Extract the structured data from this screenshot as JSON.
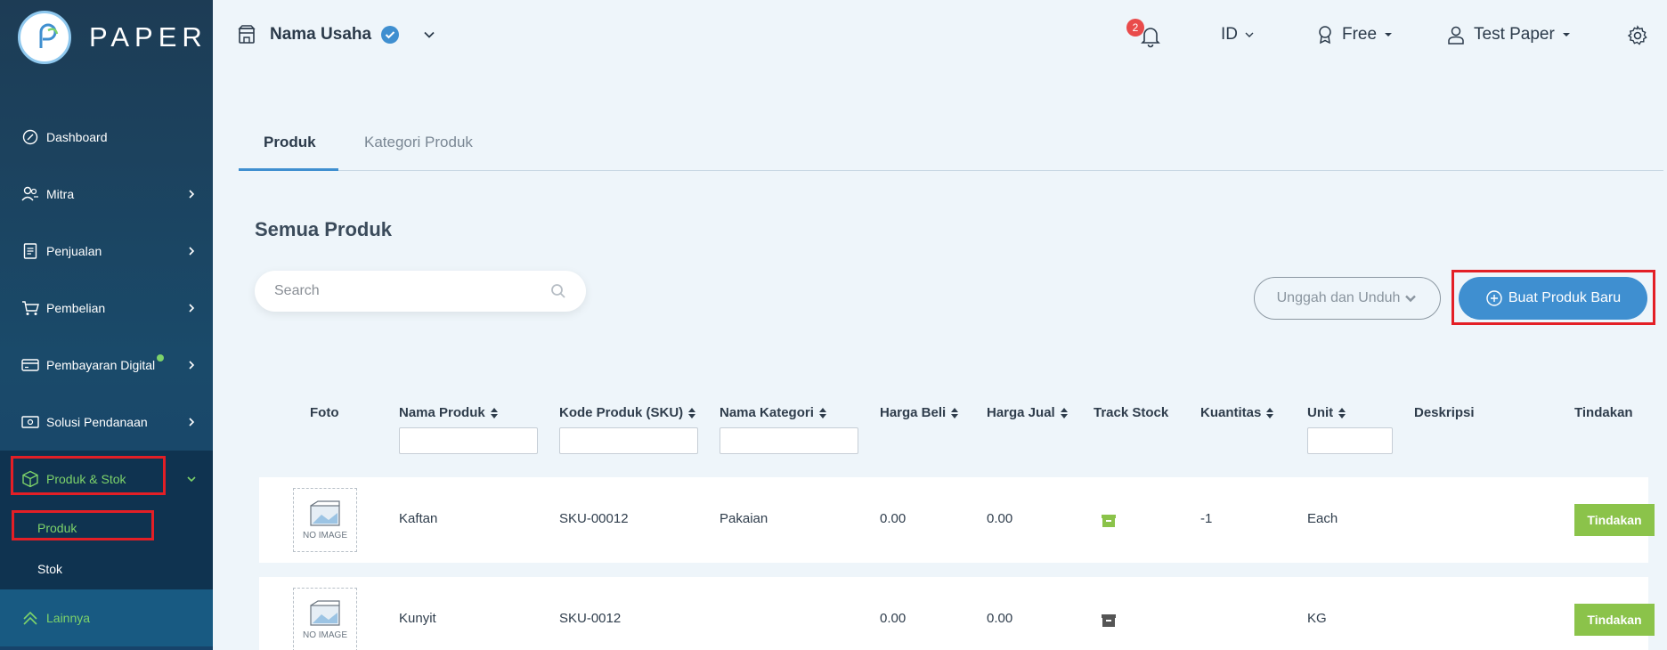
{
  "brand": {
    "name": "PAPER"
  },
  "sidebar": {
    "items": [
      {
        "label": "Dashboard",
        "icon": "dashboard-icon"
      },
      {
        "label": "Mitra",
        "icon": "partners-icon"
      },
      {
        "label": "Penjualan",
        "icon": "document-icon"
      },
      {
        "label": "Pembelian",
        "icon": "cart-icon"
      },
      {
        "label": "Pembayaran Digital",
        "icon": "card-icon"
      },
      {
        "label": "Solusi Pendanaan",
        "icon": "money-icon"
      },
      {
        "label": "Produk & Stok",
        "icon": "box-icon"
      }
    ],
    "subitems": [
      {
        "label": "Produk"
      },
      {
        "label": "Stok"
      }
    ],
    "more": {
      "label": "Lainnya"
    }
  },
  "topbar": {
    "business_name": "Nama Usaha",
    "notification_count": "2",
    "language": "ID",
    "plan": "Free",
    "user": "Test Paper"
  },
  "tabs": [
    {
      "label": "Produk",
      "active": true
    },
    {
      "label": "Kategori Produk",
      "active": false
    }
  ],
  "main": {
    "title": "Semua Produk",
    "search_placeholder": "Search",
    "upload_download_label": "Unggah dan Unduh",
    "create_button_label": "Buat Produk Baru"
  },
  "table": {
    "columns": [
      "Foto",
      "Nama Produk",
      "Kode Produk (SKU)",
      "Nama Kategori",
      "Harga Beli",
      "Harga Jual",
      "Track Stock",
      "Kuantitas",
      "Unit",
      "Deskripsi",
      "Tindakan"
    ],
    "no_image_label": "NO IMAGE",
    "action_label": "Tindakan",
    "rows": [
      {
        "name": "Kaftan",
        "sku": "SKU-00012",
        "category": "Pakaian",
        "buy": "0.00",
        "sell": "0.00",
        "track": true,
        "qty": "-1",
        "unit": "Each",
        "desc": ""
      },
      {
        "name": "Kunyit",
        "sku": "SKU-0012",
        "category": "",
        "buy": "0.00",
        "sell": "0.00",
        "track": false,
        "qty": "",
        "unit": "KG",
        "desc": ""
      }
    ]
  },
  "colors": {
    "sidebar_bg": "#1d3c55",
    "accent_green": "#7dd36a",
    "primary_blue": "#3f8fd0",
    "action_green": "#8bc34a",
    "highlight_red": "#e31f26"
  }
}
